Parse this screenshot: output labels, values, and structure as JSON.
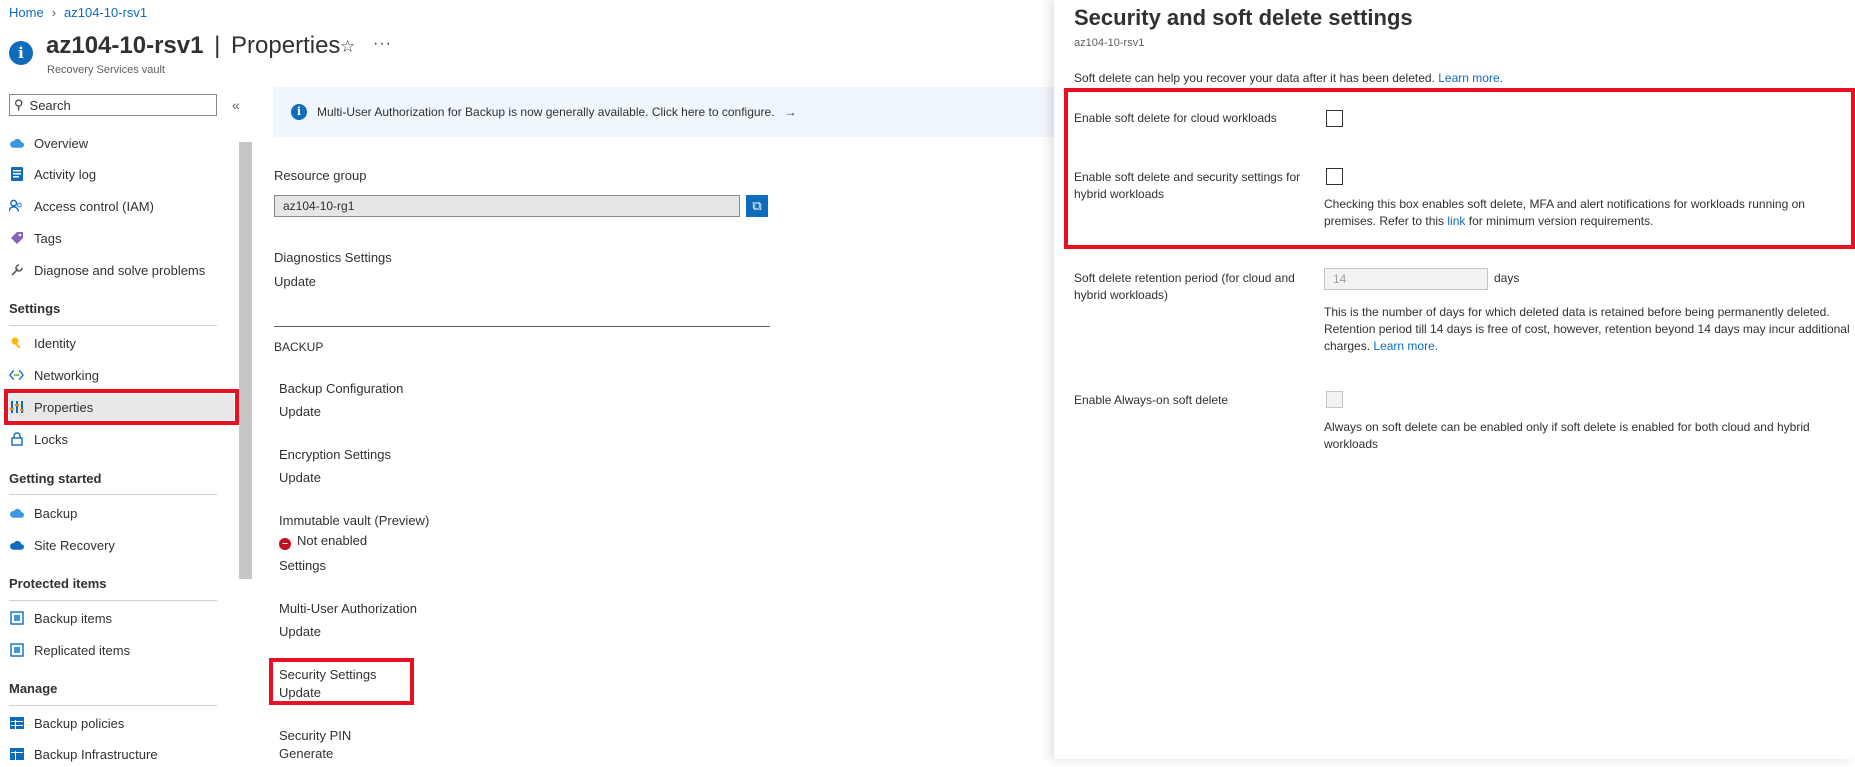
{
  "breadcrumb": {
    "home": "Home",
    "current": "az104-10-rsv1"
  },
  "header": {
    "resource_name": "az104-10-rsv1",
    "separator": "|",
    "section": "Properties",
    "subtitle": "Recovery Services vault"
  },
  "sidebar": {
    "search_placeholder": "Search",
    "items": [
      {
        "label": "Overview",
        "icon": "cloud-icon"
      },
      {
        "label": "Activity log",
        "icon": "log-icon"
      },
      {
        "label": "Access control (IAM)",
        "icon": "people-icon"
      },
      {
        "label": "Tags",
        "icon": "tag-icon"
      },
      {
        "label": "Diagnose and solve problems",
        "icon": "wrench-icon"
      }
    ],
    "groups": [
      {
        "title": "Settings",
        "items": [
          {
            "label": "Identity",
            "icon": "key-icon"
          },
          {
            "label": "Networking",
            "icon": "network-icon"
          },
          {
            "label": "Properties",
            "icon": "properties-icon",
            "selected": true
          },
          {
            "label": "Locks",
            "icon": "lock-icon"
          }
        ]
      },
      {
        "title": "Getting started",
        "items": [
          {
            "label": "Backup",
            "icon": "backup-cloud-icon"
          },
          {
            "label": "Site Recovery",
            "icon": "site-recovery-icon"
          }
        ]
      },
      {
        "title": "Protected items",
        "items": [
          {
            "label": "Backup items",
            "icon": "backup-items-icon"
          },
          {
            "label": "Replicated items",
            "icon": "replicated-items-icon"
          }
        ]
      },
      {
        "title": "Manage",
        "items": [
          {
            "label": "Backup policies",
            "icon": "table-icon"
          },
          {
            "label": "Backup Infrastructure",
            "icon": "infrastructure-icon"
          }
        ]
      }
    ]
  },
  "main": {
    "banner": "Multi-User Authorization for Backup is now generally available. Click here to configure.",
    "banner_arrow": "→",
    "resource_group_label": "Resource group",
    "resource_group_value": "az104-10-rg1",
    "diagnostics_label": "Diagnostics Settings",
    "diagnostics_link": "Update",
    "backup_heading": "BACKUP",
    "backup_config_label": "Backup Configuration",
    "backup_config_link": "Update",
    "encryption_label": "Encryption Settings",
    "encryption_link": "Update",
    "immutable_label": "Immutable vault (Preview)",
    "immutable_status": "Not enabled",
    "immutable_link": "Settings",
    "mua_label": "Multi-User Authorization",
    "mua_link": "Update",
    "security_label": "Security Settings",
    "security_link": "Update",
    "pin_label": "Security PIN",
    "pin_link": "Generate"
  },
  "panel": {
    "title": "Security and soft delete settings",
    "subtitle": "az104-10-rsv1",
    "intro": "Soft delete can help you recover your data after it has been deleted.",
    "intro_link": "Learn more.",
    "cloud_label": "Enable soft delete for cloud workloads",
    "cloud_checked": false,
    "hybrid_label": "Enable soft delete and security settings for hybrid workloads",
    "hybrid_checked": false,
    "hybrid_help_before": "Checking this box enables soft delete, MFA and alert notifications for workloads running on premises. Refer to this",
    "hybrid_help_link": "link",
    "hybrid_help_after": "for minimum version requirements.",
    "retention_label": "Soft delete retention period (for cloud and hybrid workloads)",
    "retention_value": "14",
    "retention_unit": "days",
    "retention_help": "This is the number of days for which deleted data is retained before being permanently deleted. Retention period till 14 days is free of cost, however, retention beyond 14 days may incur additional charges.",
    "retention_link": "Learn more.",
    "always_on_label": "Enable Always-on soft delete",
    "always_on_help": "Always on soft delete can be enabled only if soft delete is enabled for both cloud and hybrid workloads"
  },
  "colors": {
    "accent": "#0f6cbd",
    "highlight": "#e81123",
    "blocked": "#c50f1f"
  }
}
